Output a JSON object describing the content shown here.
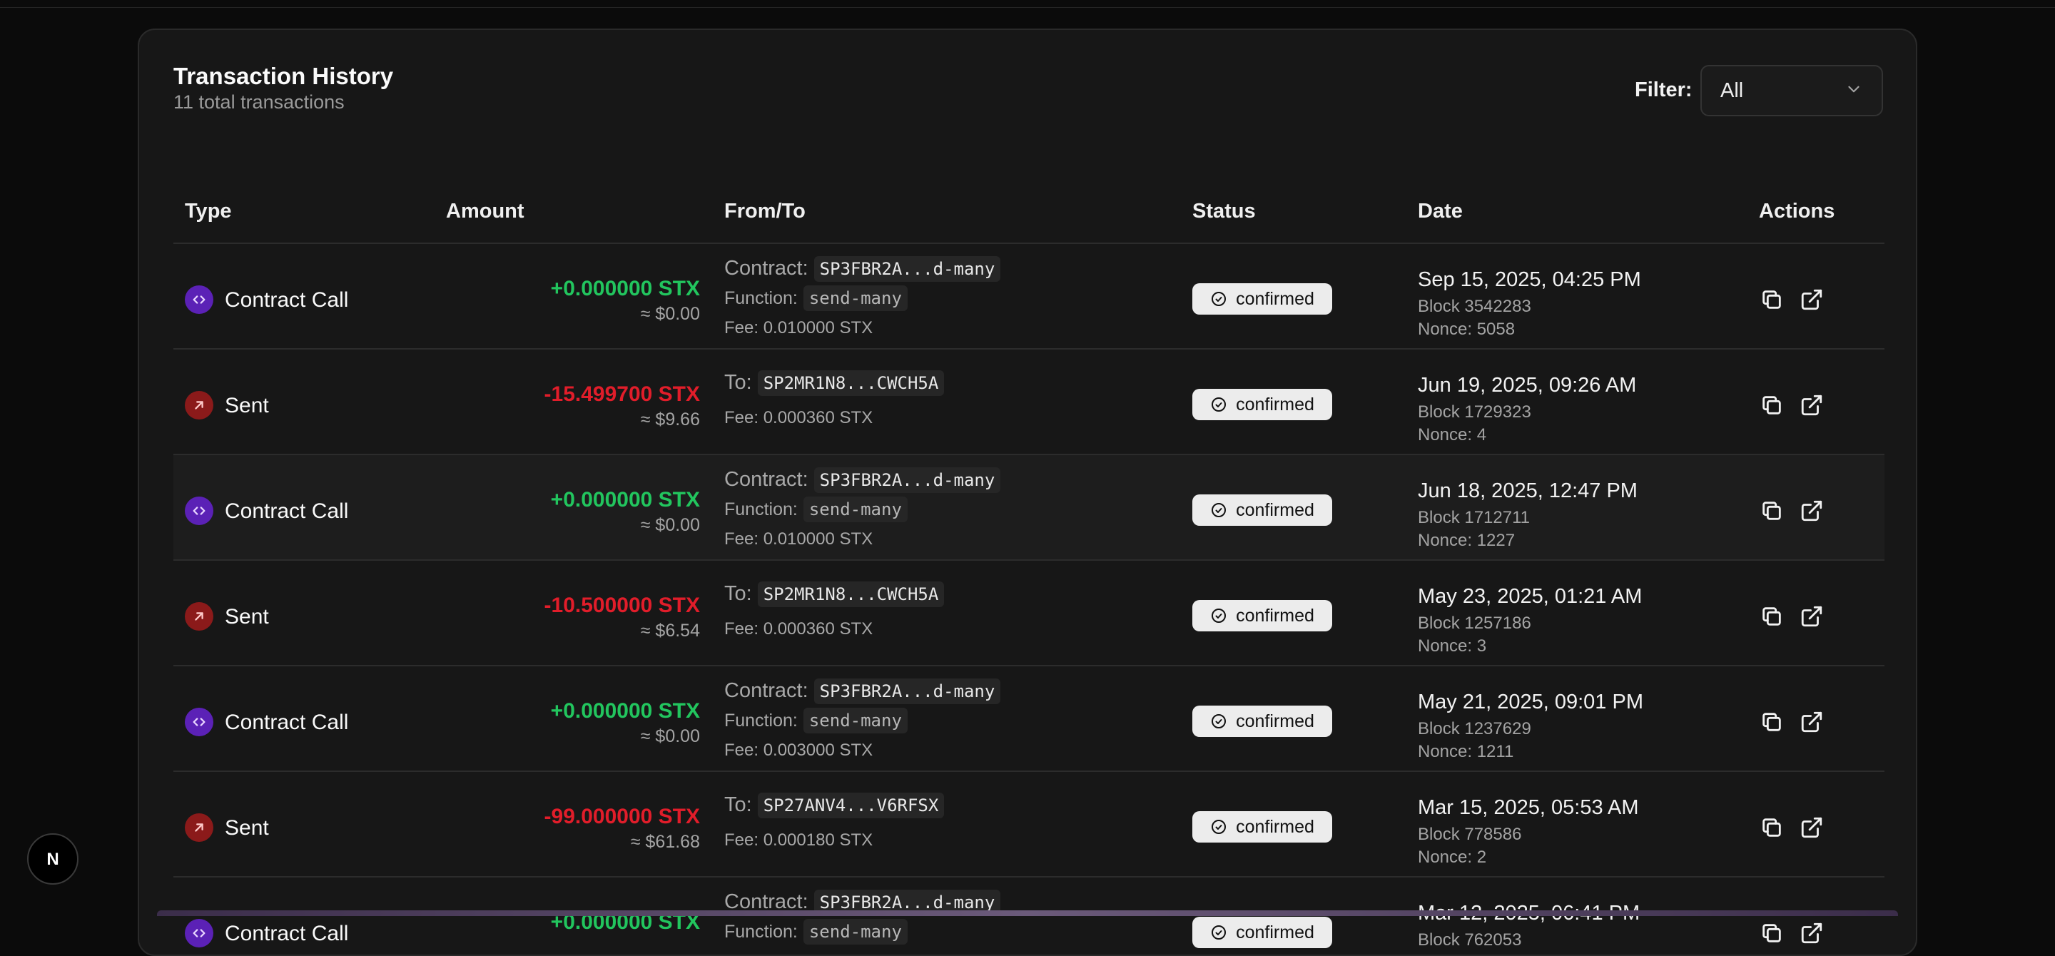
{
  "header": {
    "title": "Transaction History",
    "subtitle": "11 total transactions",
    "filter_label": "Filter:",
    "filter_value": "All"
  },
  "columns": {
    "type": "Type",
    "amount": "Amount",
    "from_to": "From/To",
    "status": "Status",
    "date": "Date",
    "actions": "Actions"
  },
  "colors": {
    "positive": "#22c55e",
    "negative": "#e11d2a",
    "contract_icon_bg": "#5b21b6",
    "sent_icon_bg": "#8b1a1a"
  },
  "rows": [
    {
      "kind": "contract",
      "icon": "code-icon",
      "type_label": "Contract Call",
      "amount": "+0.000000 STX",
      "usd": "≈ $0.00",
      "party_label": "Contract:",
      "party_value": "SP3FBR2A...d-many",
      "function_label": "Function:",
      "function_value": "send-many",
      "fee": "Fee: 0.010000 STX",
      "status": "confirmed",
      "date": "Sep 15, 2025, 04:25 PM",
      "block": "Block 3542283",
      "nonce": "Nonce: 5058"
    },
    {
      "kind": "sent",
      "icon": "arrow-up-right-icon",
      "type_label": "Sent",
      "amount": "-15.499700 STX",
      "usd": "≈ $9.66",
      "party_label": "To:",
      "party_value": "SP2MR1N8...CWCH5A",
      "fee": "Fee: 0.000360 STX",
      "status": "confirmed",
      "date": "Jun 19, 2025, 09:26 AM",
      "block": "Block 1729323",
      "nonce": "Nonce: 4"
    },
    {
      "kind": "contract",
      "icon": "code-icon",
      "type_label": "Contract Call",
      "amount": "+0.000000 STX",
      "usd": "≈ $0.00",
      "party_label": "Contract:",
      "party_value": "SP3FBR2A...d-many",
      "function_label": "Function:",
      "function_value": "send-many",
      "fee": "Fee: 0.010000 STX",
      "status": "confirmed",
      "date": "Jun 18, 2025, 12:47 PM",
      "block": "Block 1712711",
      "nonce": "Nonce: 1227"
    },
    {
      "kind": "sent",
      "icon": "arrow-up-right-icon",
      "type_label": "Sent",
      "amount": "-10.500000 STX",
      "usd": "≈ $6.54",
      "party_label": "To:",
      "party_value": "SP2MR1N8...CWCH5A",
      "fee": "Fee: 0.000360 STX",
      "status": "confirmed",
      "date": "May 23, 2025, 01:21 AM",
      "block": "Block 1257186",
      "nonce": "Nonce: 3"
    },
    {
      "kind": "contract",
      "icon": "code-icon",
      "type_label": "Contract Call",
      "amount": "+0.000000 STX",
      "usd": "≈ $0.00",
      "party_label": "Contract:",
      "party_value": "SP3FBR2A...d-many",
      "function_label": "Function:",
      "function_value": "send-many",
      "fee": "Fee: 0.003000 STX",
      "status": "confirmed",
      "date": "May 21, 2025, 09:01 PM",
      "block": "Block 1237629",
      "nonce": "Nonce: 1211"
    },
    {
      "kind": "sent",
      "icon": "arrow-up-right-icon",
      "type_label": "Sent",
      "amount": "-99.000000 STX",
      "usd": "≈ $61.68",
      "party_label": "To:",
      "party_value": "SP27ANV4...V6RFSX",
      "fee": "Fee: 0.000180 STX",
      "status": "confirmed",
      "date": "Mar 15, 2025, 05:53 AM",
      "block": "Block 778586",
      "nonce": "Nonce: 2"
    },
    {
      "kind": "contract",
      "icon": "code-icon",
      "type_label": "Contract Call",
      "amount": "+0.000000 STX",
      "usd": "",
      "party_label": "Contract:",
      "party_value": "SP3FBR2A...d-many",
      "function_label": "Function:",
      "function_value": "send-many",
      "fee": "",
      "status": "confirmed",
      "date": "Mar 12, 2025, 06:41 PM",
      "block": "Block 762053",
      "nonce": ""
    }
  ],
  "dev_badge": {
    "letter": "N"
  }
}
